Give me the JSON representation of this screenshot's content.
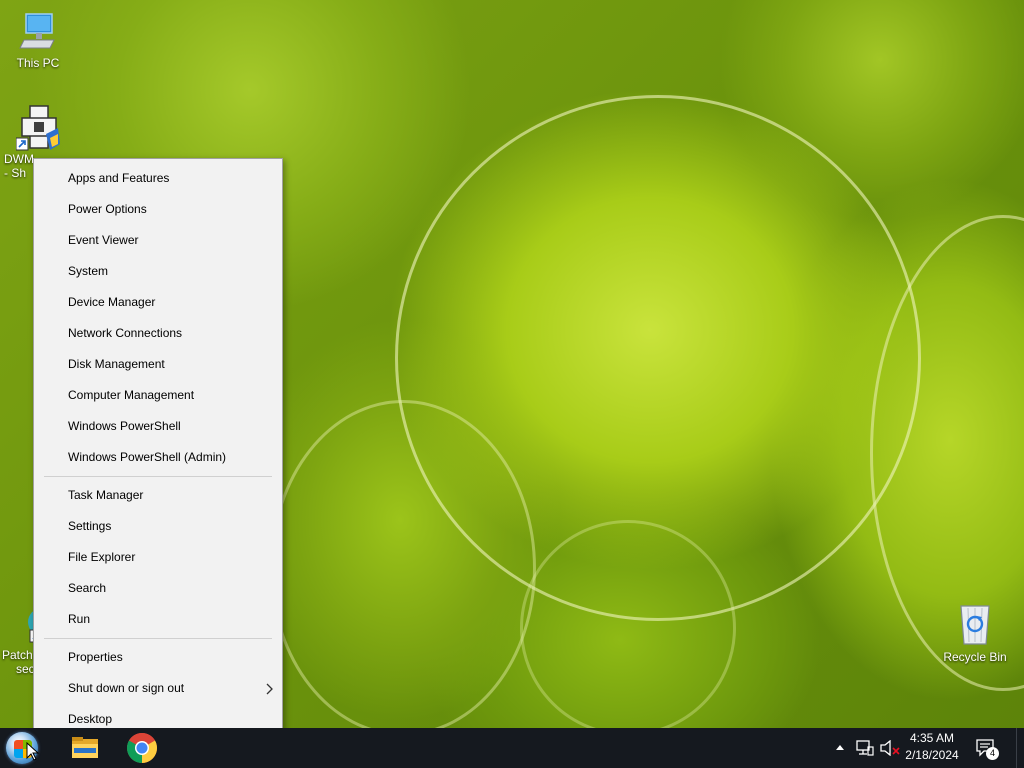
{
  "desktop": {
    "icons": [
      {
        "name": "this-pc",
        "label": "This PC",
        "icon": "computer-icon"
      },
      {
        "name": "dwm-shortcut",
        "label": "DWM",
        "label2": "- Sh",
        "icon": "package-icon"
      },
      {
        "name": "patch-shortcut",
        "label": "Patch",
        "label2": "sec",
        "icon": "shortcut-icon"
      },
      {
        "name": "recycle-bin",
        "label": "Recycle Bin",
        "icon": "recycle-bin-icon"
      }
    ]
  },
  "menu": {
    "group1": [
      "Apps and Features",
      "Power Options",
      "Event Viewer",
      "System",
      "Device Manager",
      "Network Connections",
      "Disk Management",
      "Computer Management",
      "Windows PowerShell",
      "Windows PowerShell (Admin)"
    ],
    "group2": [
      "Task Manager",
      "Settings",
      "File Explorer",
      "Search",
      "Run"
    ],
    "group3": [
      "Properties",
      "Shut down or sign out",
      "Desktop"
    ],
    "submenu_glyph": ">"
  },
  "taskbar": {
    "pinned": [
      {
        "name": "start-orb",
        "icon": "windows-orb-icon"
      },
      {
        "name": "file-explorer",
        "icon": "folder-icon"
      },
      {
        "name": "chrome",
        "icon": "chrome-icon"
      }
    ],
    "tray": {
      "time": "4:35 AM",
      "date": "2/18/2024",
      "notifications_count": "4",
      "icons": [
        "chevron-up-icon",
        "network-icon",
        "volume-muted-icon",
        "action-center-icon"
      ]
    }
  },
  "colors": {
    "menu_bg": "#f2f2f2",
    "taskbar_bg": "#15191f",
    "wallpaper_green": "#a8cc18"
  }
}
